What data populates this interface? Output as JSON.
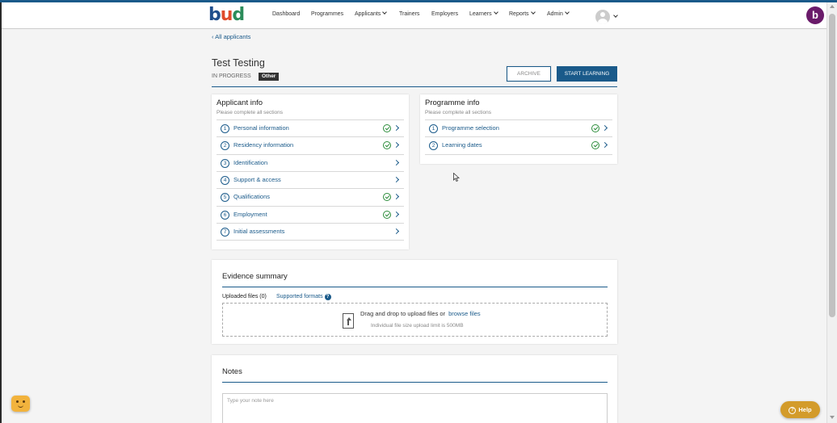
{
  "brand": {
    "logo_letters": [
      "b",
      "u",
      "d"
    ],
    "circle_letter": "b",
    "colors": {
      "primary": "#1a5a8a",
      "logo_b": "#1f4e8c",
      "logo_u": "#e04b2b",
      "logo_d": "#2b8c5a",
      "success": "#2b8c3a",
      "help": "#d39b2a"
    }
  },
  "nav": {
    "dashboard": "Dashboard",
    "programmes": "Programmes",
    "applicants": "Applicants",
    "trainers": "Trainers",
    "employers": "Employers",
    "learners": "Learners",
    "reports": "Reports",
    "admin": "Admin"
  },
  "back_link": "All applicants",
  "applicant": {
    "name": "Test Testing",
    "status": "IN PROGRESS",
    "tag": "Other"
  },
  "actions": {
    "archive": "ARCHIVE",
    "start": "START LEARNING"
  },
  "applicant_info": {
    "title": "Applicant info",
    "subtitle": "Please complete all sections",
    "items": [
      {
        "num": "1",
        "label": "Personal information",
        "complete": true
      },
      {
        "num": "2",
        "label": "Residency information",
        "complete": true
      },
      {
        "num": "3",
        "label": "Identification",
        "complete": false
      },
      {
        "num": "4",
        "label": "Support & access",
        "complete": false
      },
      {
        "num": "5",
        "label": "Qualifications",
        "complete": true
      },
      {
        "num": "6",
        "label": "Employment",
        "complete": true
      },
      {
        "num": "7",
        "label": "Initial assessments",
        "complete": false
      }
    ]
  },
  "programme_info": {
    "title": "Programme info",
    "subtitle": "Please complete all sections",
    "items": [
      {
        "num": "1",
        "label": "Programme selection",
        "complete": true
      },
      {
        "num": "2",
        "label": "Learning dates",
        "complete": true
      }
    ]
  },
  "evidence": {
    "title": "Evidence summary",
    "uploaded": "Uploaded files (0)",
    "formats": "Supported formats",
    "drop_text": "Drag and drop to upload files or",
    "browse": "browse files",
    "limit": "Individual file size upload limit is 500MB"
  },
  "notes": {
    "title": "Notes",
    "placeholder": "Type your note here"
  },
  "help": {
    "label": "Help"
  },
  "icons": [
    "chevron-left-icon",
    "chevron-down-icon",
    "avatar-icon",
    "check-circle-icon",
    "chevron-right-icon",
    "question-icon",
    "file-upload-icon",
    "chat-icon",
    "help-icon"
  ]
}
